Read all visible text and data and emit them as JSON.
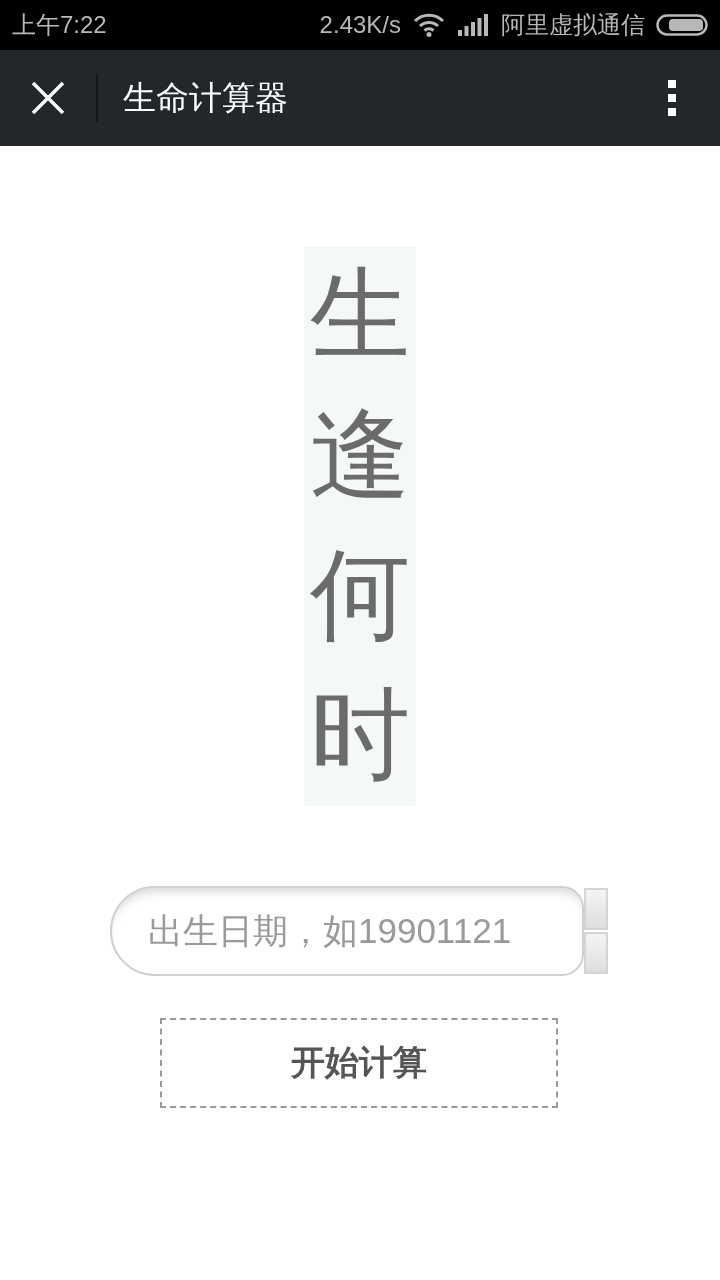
{
  "status_bar": {
    "time": "上午7:22",
    "network_speed": "2.43K/s",
    "carrier": "阿里虚拟通信"
  },
  "nav_bar": {
    "title": "生命计算器"
  },
  "banner": {
    "text": "生逢何时"
  },
  "birth_date_field": {
    "placeholder": "出生日期，如19901121"
  },
  "start_button": {
    "label": "开始计算"
  }
}
